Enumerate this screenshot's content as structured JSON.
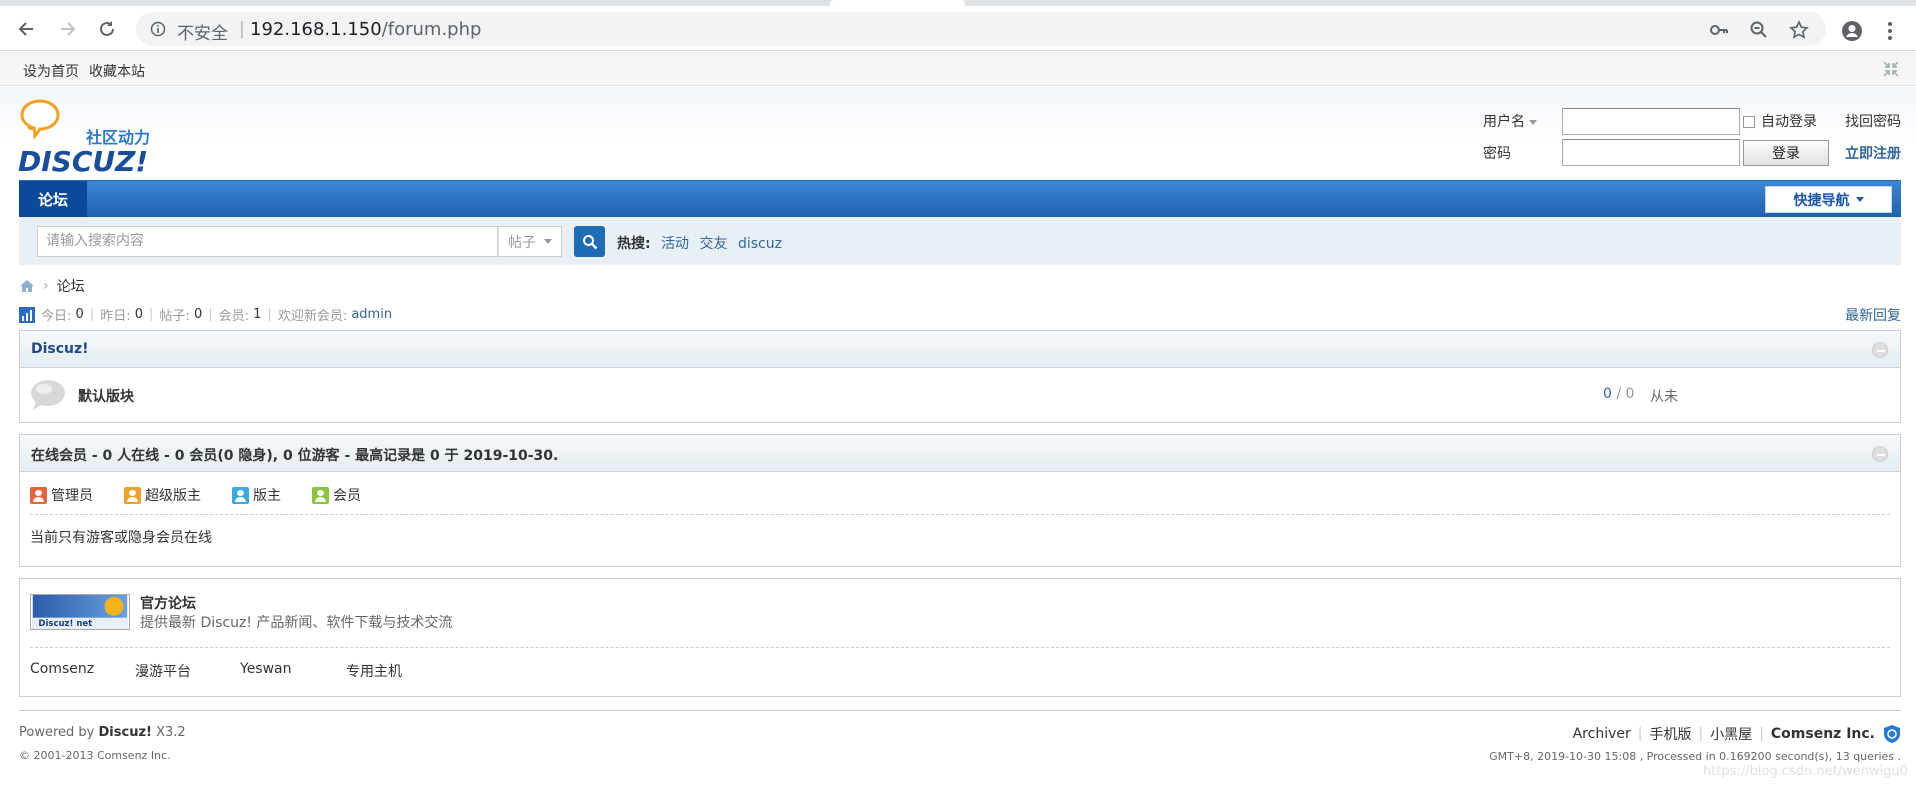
{
  "browser": {
    "security_label": "不安全",
    "separator": "|",
    "url_host": "192.168.1.150",
    "url_path": "/forum.php"
  },
  "topbar": {
    "set_home": "设为首页",
    "bookmark": "收藏本站"
  },
  "login": {
    "username_label": "用户名",
    "password_label": "密码",
    "auto_login": "自动登录",
    "forgot_password": "找回密码",
    "login_button": "登录",
    "register": "立即注册"
  },
  "nav": {
    "forum_tab": "论坛",
    "quick_nav": "快捷导航"
  },
  "search": {
    "placeholder": "请输入搜索内容",
    "type": "帖子",
    "hot_label": "热搜:",
    "hot_terms": [
      "活动",
      "交友",
      "discuz"
    ]
  },
  "breadcrumb": {
    "current": "论坛"
  },
  "stats": {
    "today_label": "今日:",
    "today": "0",
    "yesterday_label": "昨日:",
    "yesterday": "0",
    "posts_label": "帖子:",
    "posts": "0",
    "members_label": "会员:",
    "members": "1",
    "welcome_label": "欢迎新会员:",
    "new_member": "admin",
    "latest_replies": "最新回复"
  },
  "category": {
    "title": "Discuz!",
    "forums": [
      {
        "name": "默认版块",
        "threads": "0",
        "sep": " / ",
        "posts": "0",
        "last_post": "从未"
      }
    ]
  },
  "online": {
    "title": "在线会员 - 0 人在线 - 0 会员(0 隐身), 0 位游客 - 最高记录是 0 于 2019-10-30.",
    "legend": [
      "管理员",
      "超级版主",
      "版主",
      "会员"
    ],
    "message": "当前只有游客或隐身会员在线"
  },
  "links": {
    "banner_text": "Discuz! net",
    "title": "官方论坛",
    "desc": "提供最新 Discuz! 产品新闻、软件下载与技术交流",
    "items": [
      "Comsenz",
      "漫游平台",
      "Yeswan",
      "专用主机"
    ]
  },
  "footer": {
    "powered_by": "Powered by",
    "product": "Discuz!",
    "version": "X3.2",
    "copyright": "© 2001-2013 Comsenz Inc.",
    "archiver": "Archiver",
    "mobile": "手机版",
    "blackroom": "小黑屋",
    "company": "Comsenz Inc.",
    "gmt_info": "GMT+8, 2019-10-30 15:08 , Processed in 0.169200 second(s), 13 queries .",
    "watermark": "https://blog.csdn.net/wenwigu0"
  },
  "colors": {
    "nav_blue": "#1f62b1",
    "link_blue": "#336699",
    "admin_orange": "#e8633b",
    "super_mod": "#f0a030",
    "moderator": "#3ba9e0",
    "member_green": "#8ac43c"
  }
}
